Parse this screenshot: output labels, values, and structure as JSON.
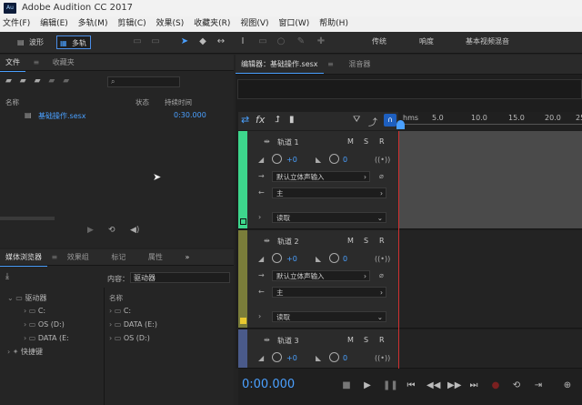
{
  "window": {
    "title": "Adobe Audition CC 2017",
    "logo": "Au"
  },
  "menu": [
    "文件(F)",
    "编辑(E)",
    "多轨(M)",
    "剪辑(C)",
    "效果(S)",
    "收藏夹(R)",
    "视图(V)",
    "窗口(W)",
    "帮助(H)"
  ],
  "toolbar": {
    "waveform": "波形",
    "multitrack": "多轨",
    "workspaces": [
      "传统",
      "响度",
      "基本视频混音"
    ]
  },
  "files_panel": {
    "tabs": [
      "文件",
      "收藏夹"
    ],
    "columns": {
      "name": "名称",
      "status": "状态",
      "duration": "持续时间"
    },
    "items": [
      {
        "name": "基础操作.sesx",
        "duration": "0:30.000"
      }
    ]
  },
  "media_panel": {
    "tabs": [
      "媒体浏览器",
      "效果组",
      "标记",
      "属性"
    ],
    "content_label": "内容：",
    "content_value": "驱动器",
    "tree": [
      "驱动器",
      "C:",
      "OS (D:)",
      "DATA (E:",
      "快捷键"
    ],
    "list_header": "名称",
    "list": [
      "C:",
      "DATA (E:)",
      "OS (D:)"
    ]
  },
  "editor": {
    "tabs": [
      "编辑器：基础操作.sesx",
      "混音器"
    ],
    "ruler": [
      "hms",
      "5.0",
      "10.0",
      "15.0",
      "20.0",
      "25"
    ],
    "tracks": [
      {
        "name": "轨道 1",
        "vol": "+0",
        "pan": "0",
        "input": "默认立体声输入",
        "output": "主",
        "mode": "读取",
        "color": "#3dd68c"
      },
      {
        "name": "轨道 2",
        "vol": "+0",
        "pan": "0",
        "input": "默认立体声输入",
        "output": "主",
        "mode": "读取",
        "color": "#7a7d3a"
      },
      {
        "name": "轨道 3",
        "vol": "+0",
        "pan": "0",
        "color": "#4a5a8a"
      }
    ],
    "msr": [
      "M",
      "S",
      "R"
    ],
    "time": "0:00.000"
  },
  "icons": [
    "search-icon",
    "play-icon",
    "loop-icon",
    "speaker-icon",
    "fx-icon"
  ]
}
